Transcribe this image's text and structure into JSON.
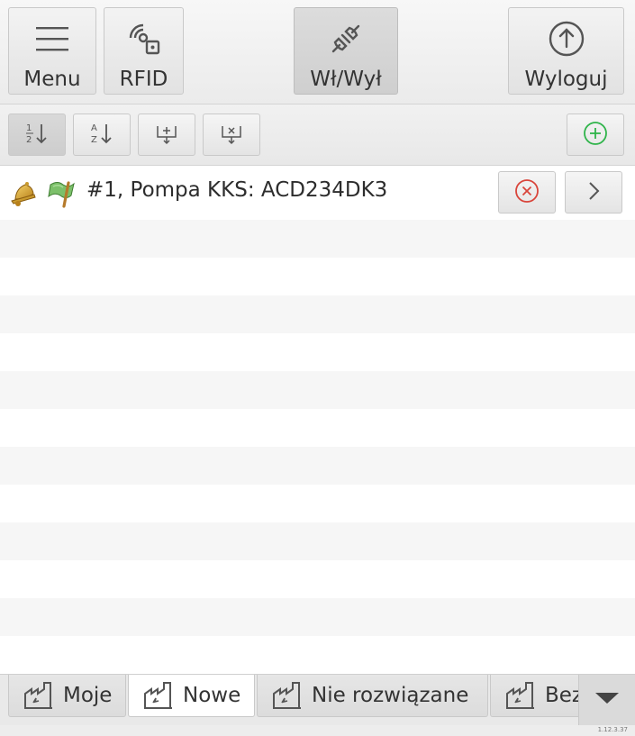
{
  "toolbar": {
    "menu_label": "Menu",
    "rfid_label": "RFID",
    "onoff_label": "Wł/Wył",
    "logout_label": "Wyloguj"
  },
  "subtoolbar": {
    "sort_numeric_icon": "sort-numeric-icon",
    "sort_alpha_icon": "sort-alpha-icon",
    "expand_icon": "expand-all-icon",
    "collapse_icon": "collapse-all-icon",
    "add_icon": "add-icon"
  },
  "list": {
    "items": [
      {
        "text": "#1, Pompa KKS: ACD234DK3"
      }
    ]
  },
  "tabs": [
    {
      "label": "Moje"
    },
    {
      "label": "Nowe"
    },
    {
      "label": "Nie rozwiązane"
    },
    {
      "label": "Bez"
    }
  ],
  "version": "1.12.3.37",
  "colors": {
    "accent_green": "#2fb44a",
    "cancel_red": "#d9453b",
    "stripe": "#f6f6f6"
  }
}
